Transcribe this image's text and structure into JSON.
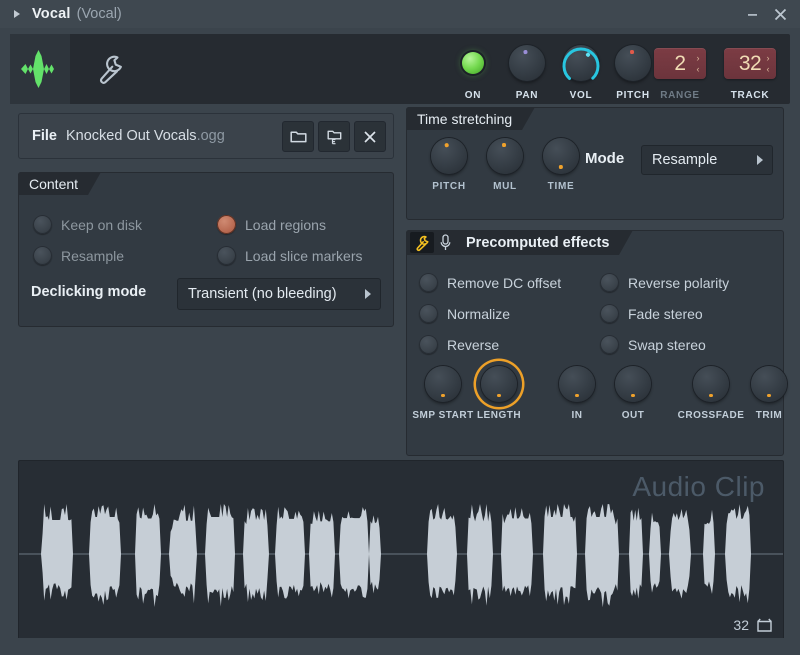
{
  "window": {
    "title": "Vocal",
    "subtitle": "(Vocal)",
    "expand_arrow": "play-triangle",
    "minimize_label": "minimize",
    "close_label": "close"
  },
  "toolbar": {
    "logo_icon": "waveform-icon",
    "wrench_icon": "wrench-icon",
    "controls": [
      {
        "name": "on",
        "label": "ON",
        "type": "led",
        "state": "on",
        "color": "#74d94f"
      },
      {
        "name": "pan",
        "label": "PAN",
        "type": "knob",
        "dot_color": "#9a8ed6",
        "angle": -8
      },
      {
        "name": "vol",
        "label": "VOL",
        "type": "knob-ring",
        "dot_color": "#3fd0e8",
        "ring_color": "#28c6e0",
        "angle": 40
      },
      {
        "name": "pitch",
        "label": "PITCH",
        "type": "knob",
        "dot_color": "#e05a4a",
        "angle": -5
      },
      {
        "name": "range",
        "label": "RANGE",
        "type": "value",
        "value": "2",
        "dim": true
      },
      {
        "name": "track",
        "label": "TRACK",
        "type": "value",
        "value": "32",
        "dim": false
      }
    ]
  },
  "file": {
    "label": "File",
    "name": "Knocked Out Vocals",
    "extension": ".ogg",
    "buttons": [
      {
        "name": "open-folder",
        "icon": "folder-icon"
      },
      {
        "name": "recent-files",
        "icon": "folder-e-icon"
      },
      {
        "name": "clear-file",
        "icon": "close-x-icon"
      }
    ]
  },
  "content": {
    "title": "Content",
    "options": [
      {
        "name": "keep-on-disk",
        "label": "Keep on disk",
        "checked": false,
        "disabled": true
      },
      {
        "name": "load-regions",
        "label": "Load regions",
        "checked": true,
        "disabled": true
      },
      {
        "name": "resample",
        "label": "Resample",
        "checked": false,
        "disabled": true
      },
      {
        "name": "load-slice-markers",
        "label": "Load slice markers",
        "checked": false,
        "disabled": true
      }
    ],
    "declicking_label": "Declicking mode",
    "declicking_value": "Transient (no bleeding)"
  },
  "time_stretching": {
    "title": "Time stretching",
    "knobs": [
      {
        "name": "pitch",
        "label": "PITCH",
        "dot_color": "#f0a22c",
        "angle": -12
      },
      {
        "name": "mul",
        "label": "MUL",
        "dot_color": "#f0a22c",
        "angle": -5
      },
      {
        "name": "time",
        "label": "TIME",
        "dot_color": "#f0a22c",
        "angle": 178
      }
    ],
    "mode_label": "Mode",
    "mode_value": "Resample"
  },
  "precomputed": {
    "title": "Precomputed effects",
    "wrench_icon": "wrench-icon",
    "mic_icon": "microphone-icon",
    "effects_left": [
      {
        "name": "remove-dc-offset",
        "label": "Remove DC offset",
        "checked": false
      },
      {
        "name": "normalize",
        "label": "Normalize",
        "checked": false
      },
      {
        "name": "reverse",
        "label": "Reverse",
        "checked": false
      }
    ],
    "effects_right": [
      {
        "name": "reverse-polarity",
        "label": "Reverse polarity",
        "checked": false
      },
      {
        "name": "fade-stereo",
        "label": "Fade stereo",
        "checked": false
      },
      {
        "name": "swap-stereo",
        "label": "Swap stereo",
        "checked": false
      }
    ],
    "knobs": [
      {
        "name": "smp-start",
        "label": "SMP START",
        "dot_color": "#f0a22c",
        "highlight": false
      },
      {
        "name": "length",
        "label": "LENGTH",
        "dot_color": "#f0a22c",
        "highlight": true
      },
      {
        "name": "in",
        "label": "IN",
        "dot_color": "#f0a22c",
        "highlight": false
      },
      {
        "name": "out",
        "label": "OUT",
        "dot_color": "#f0a22c",
        "highlight": false
      },
      {
        "name": "crossfade",
        "label": "CROSSFADE",
        "dot_color": "#f0a22c",
        "highlight": false
      },
      {
        "name": "trim",
        "label": "TRIM",
        "dot_color": "#f0a22c",
        "highlight": false
      }
    ]
  },
  "waveform": {
    "watermark": "Audio Clip",
    "channel_number": "32",
    "channel_icon": "clip-icon",
    "color": "#c6ced6",
    "background": "#272d34"
  },
  "colors": {
    "accent_orange": "#eda028",
    "accent_cyan": "#28c6e0",
    "accent_green": "#74d94f",
    "panel_bg": "#323a42",
    "dark_bg": "#262b31",
    "titlebar": "#3f4850"
  }
}
